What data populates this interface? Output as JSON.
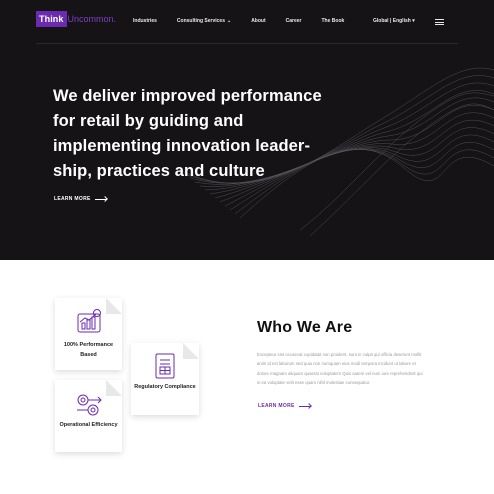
{
  "brand": {
    "think": "Think",
    "uncommon": "Uncommon.",
    "color": "#6a2bb0"
  },
  "nav": {
    "items": [
      {
        "label": "Industries"
      },
      {
        "label": "Consulting Services",
        "has_dropdown": true
      },
      {
        "label": "About"
      },
      {
        "label": "Career"
      },
      {
        "label": "The Book"
      }
    ],
    "language": "Global | English",
    "menu_icon": "hamburger-menu-icon"
  },
  "hero": {
    "headline_lines": [
      "We deliver improved performance",
      "for retail by guiding and",
      "implementing innovation leader-",
      "ship, practices and culture"
    ],
    "cta": "LEARN MORE",
    "background": "#151316"
  },
  "cards": [
    {
      "label": "100% Performance Based",
      "icon": "performance-chart-icon"
    },
    {
      "label": "Regulatory Compliance",
      "icon": "compliance-document-icon"
    },
    {
      "label": "Operational Efficiency",
      "icon": "efficiency-gears-icon"
    }
  ],
  "who": {
    "title": "Who We Are",
    "text_lines": [
      "Excepteur sint occaecat cupidatat non proident, sunt in culpa qui officia deserunt mollit",
      "anim id est laborum sed quia non numquam eius modi tempora incidunt ut labore et",
      "dolore magnam aliquam quaerat voluptatem Quis autem vel eum iure reprehenderit qui",
      "in ea voluptate velit esse quam nihil molestiae consequatur."
    ],
    "cta": "LEARN MORE"
  }
}
